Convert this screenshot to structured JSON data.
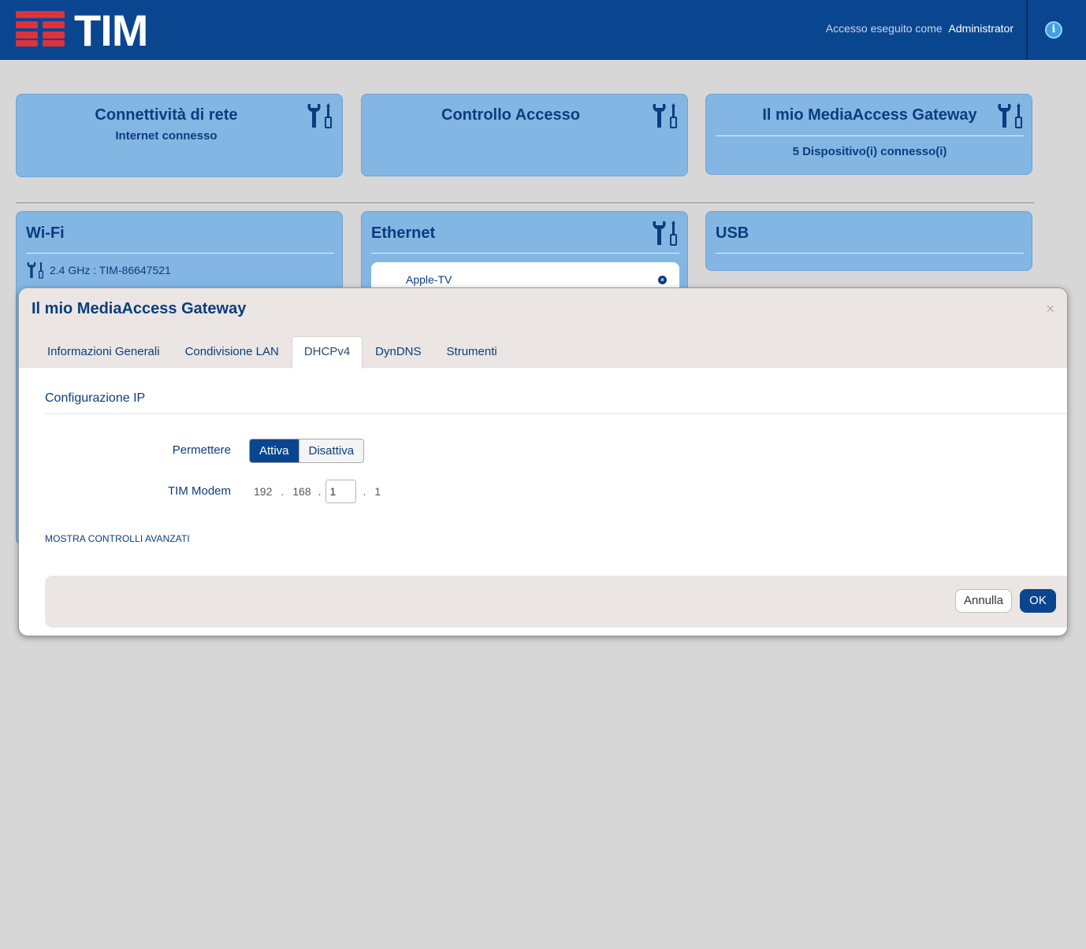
{
  "header": {
    "brand": "TIM",
    "login_prefix": "Accesso eseguito come",
    "login_user": "Administrator",
    "info_icon": "i",
    "brand_red": "#e0313a",
    "brand_blue": "#0a4690"
  },
  "cards": {
    "network": {
      "title": "Connettività di rete",
      "status": "Internet connesso"
    },
    "access": {
      "title": "Controllo Accesso"
    },
    "gateway": {
      "title": "Il mio MediaAccess Gateway",
      "status": "5 Dispositivo(i) connesso(i)"
    },
    "wifi": {
      "title": "Wi-Fi",
      "band": "2.4 GHz : TIM-86647521"
    },
    "ethernet": {
      "title": "Ethernet",
      "device": "Apple-TV"
    },
    "usb": {
      "title": "USB"
    }
  },
  "modal": {
    "title": "Il mio MediaAccess Gateway",
    "close": "×",
    "tabs": [
      {
        "label": "Informazioni Generali"
      },
      {
        "label": "Condivisione LAN"
      },
      {
        "label": "DHCPv4"
      },
      {
        "label": "DynDNS"
      },
      {
        "label": "Strumenti"
      }
    ],
    "active_tab": "DHCPv4",
    "section_title": "Configurazione IP",
    "permit": {
      "label": "Permettere",
      "on_label": "Attiva",
      "off_label": "Disattiva",
      "selected": "Attiva"
    },
    "modem": {
      "label": "TIM Modem",
      "oct1": "192",
      "oct2": "168",
      "oct3": "1",
      "oct4": "1"
    },
    "advanced_link": "MOSTRA CONTROLLI AVANZATI",
    "cancel_label": "Annulla",
    "ok_label": "OK"
  }
}
